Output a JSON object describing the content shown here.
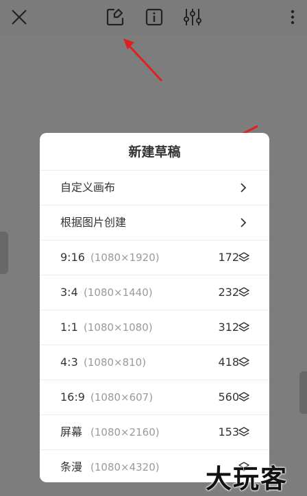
{
  "toolbar": {
    "close_icon": "close-icon",
    "new_draft_icon": "new-draft-icon",
    "info_icon": "info-icon",
    "adjust_icon": "sliders-icon",
    "more_icon": "more-vertical-icon"
  },
  "dialog": {
    "title": "新建草稿",
    "custom_canvas": "自定义画布",
    "from_image": "根据图片创建",
    "presets": [
      {
        "ratio": "9:16",
        "dims": "(1080×1920)",
        "count": "172"
      },
      {
        "ratio": "3:4",
        "dims": "(1080×1440)",
        "count": "232"
      },
      {
        "ratio": "1:1",
        "dims": "(1080×1080)",
        "count": "312"
      },
      {
        "ratio": "4:3",
        "dims": "(1080×810)",
        "count": "418"
      },
      {
        "ratio": "16:9",
        "dims": "(1080×607)",
        "count": "560"
      },
      {
        "ratio": "屏幕",
        "dims": "(1080×2160)",
        "count": "153"
      },
      {
        "ratio": "条漫",
        "dims": "(1080×4320)",
        "count": ""
      }
    ]
  },
  "watermark": "大玩客",
  "colors": {
    "annotation_arrow": "#e02020",
    "overlay": "#7d7d7d",
    "sheet": "#ffffff"
  }
}
